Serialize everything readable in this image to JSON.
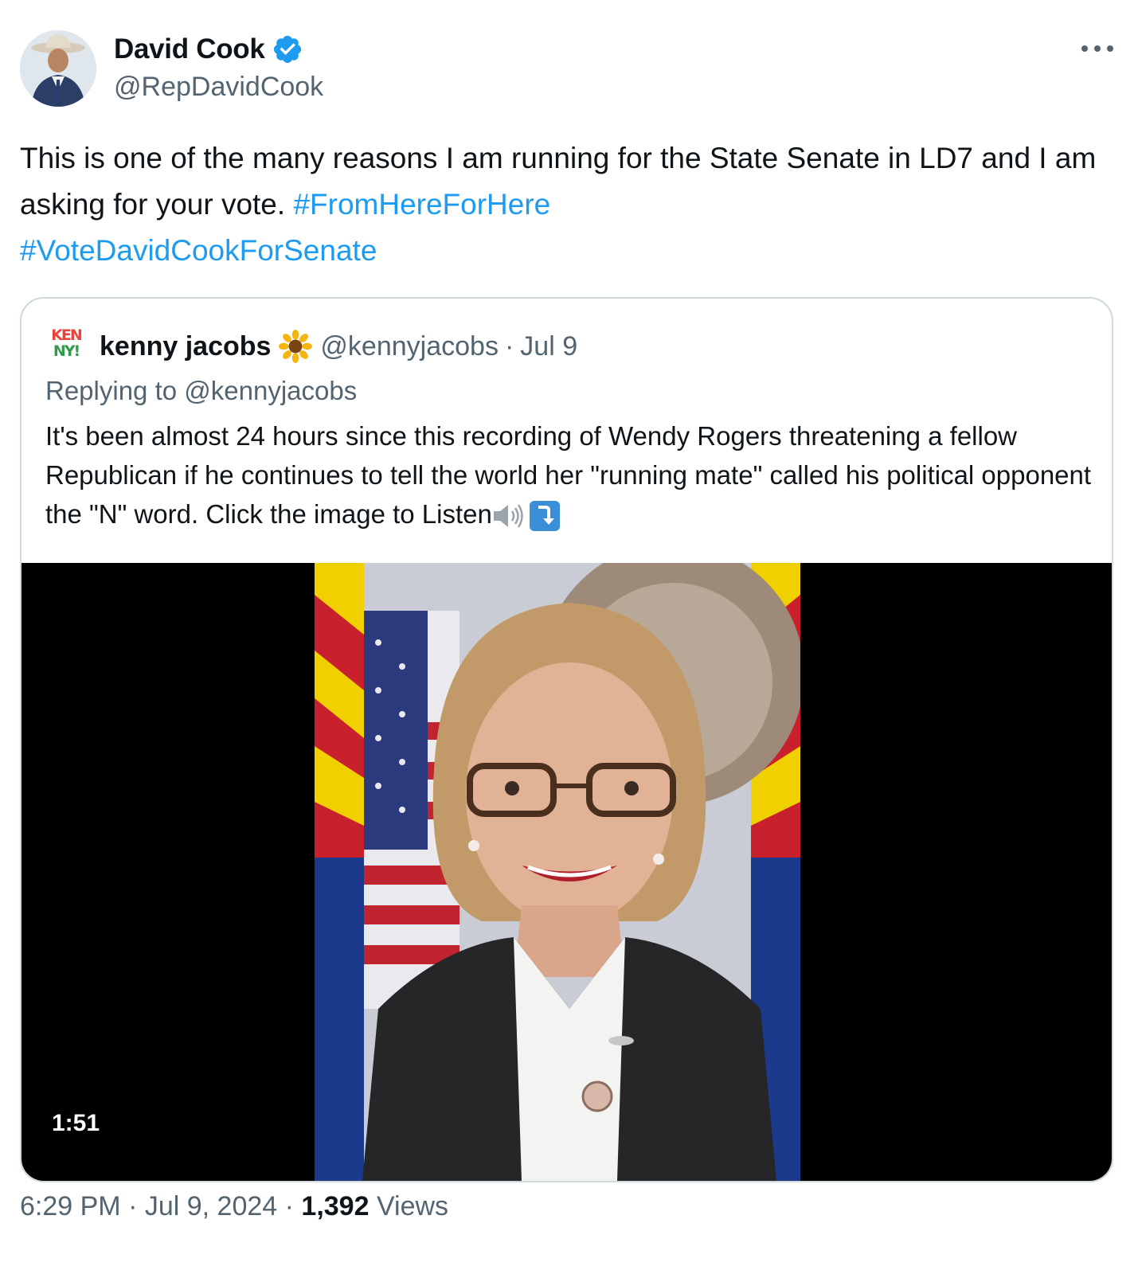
{
  "author": {
    "display_name": "David Cook",
    "handle": "@RepDavidCook",
    "verified_icon": "verified-badge-icon",
    "avatar_icon": "avatar-photo"
  },
  "tweet": {
    "text_plain": "This is one of the many reasons I am running for the State Senate in LD7 and I am asking for your vote. ",
    "hashtag_1": "#FromHereForHere",
    "hashtag_2": "#VoteDavidCookForSenate",
    "more_icon": "more-options-icon"
  },
  "quoted": {
    "avatar_text_1": "KEN",
    "avatar_text_2": "NY!",
    "display_name": "kenny jacobs",
    "name_emoji": "sunflower-icon",
    "handle": "@kennyjacobs",
    "separator": "·",
    "date": "Jul 9",
    "replying_to": "Replying to @kennyjacobs",
    "text": "It's been almost 24 hours since this recording of Wendy Rogers threatening a fellow Republican if he continues to tell the world her \"running mate\" called his political opponent the \"N\" word. Click the image to Listen",
    "trailing_icons": [
      "speaker-icon",
      "arrow-down-icon"
    ],
    "video_duration": "1:51"
  },
  "footer": {
    "time": "6:29 PM",
    "sep1": " · ",
    "date": "Jul 9, 2024",
    "sep2": " · ",
    "views_count": "1,392",
    "views_label": " Views"
  },
  "colors": {
    "link": "#1d9bf0",
    "secondary": "#536471",
    "text": "#0f1419",
    "border": "#cfd9de"
  }
}
